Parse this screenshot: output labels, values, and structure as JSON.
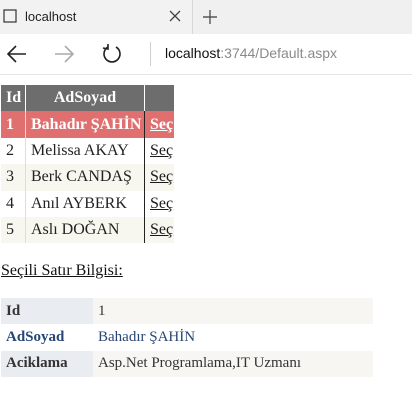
{
  "browser": {
    "tab_title": "localhost",
    "address_host": "localhost",
    "address_rest": ":3744/Default.aspx"
  },
  "grid": {
    "headers": [
      "Id",
      "AdSoyad",
      ""
    ],
    "select_label": "Seç",
    "rows": [
      {
        "id": "1",
        "name": "Bahadır ŞAHİN"
      },
      {
        "id": "2",
        "name": "Melissa AKAY"
      },
      {
        "id": "3",
        "name": "Berk CANDAŞ"
      },
      {
        "id": "4",
        "name": "Anıl AYBERK"
      },
      {
        "id": "5",
        "name": "Aslı DOĞAN"
      }
    ]
  },
  "details": {
    "title": "Seçili Satır Bilgisi:",
    "rows": [
      {
        "label": "Id",
        "value": "1"
      },
      {
        "label": "AdSoyad",
        "value": "Bahadır ŞAHİN"
      },
      {
        "label": "Aciklama",
        "value": "Asp.Net Programlama,IT Uzmanı"
      }
    ]
  },
  "colors": {
    "header_bg": "#6d6d6d",
    "selected_row_bg": "#e06f6f",
    "details_accent": "#284775"
  },
  "icons": [
    "page-icon",
    "close-icon",
    "plus-icon",
    "back-arrow-icon",
    "forward-arrow-icon",
    "refresh-icon"
  ]
}
